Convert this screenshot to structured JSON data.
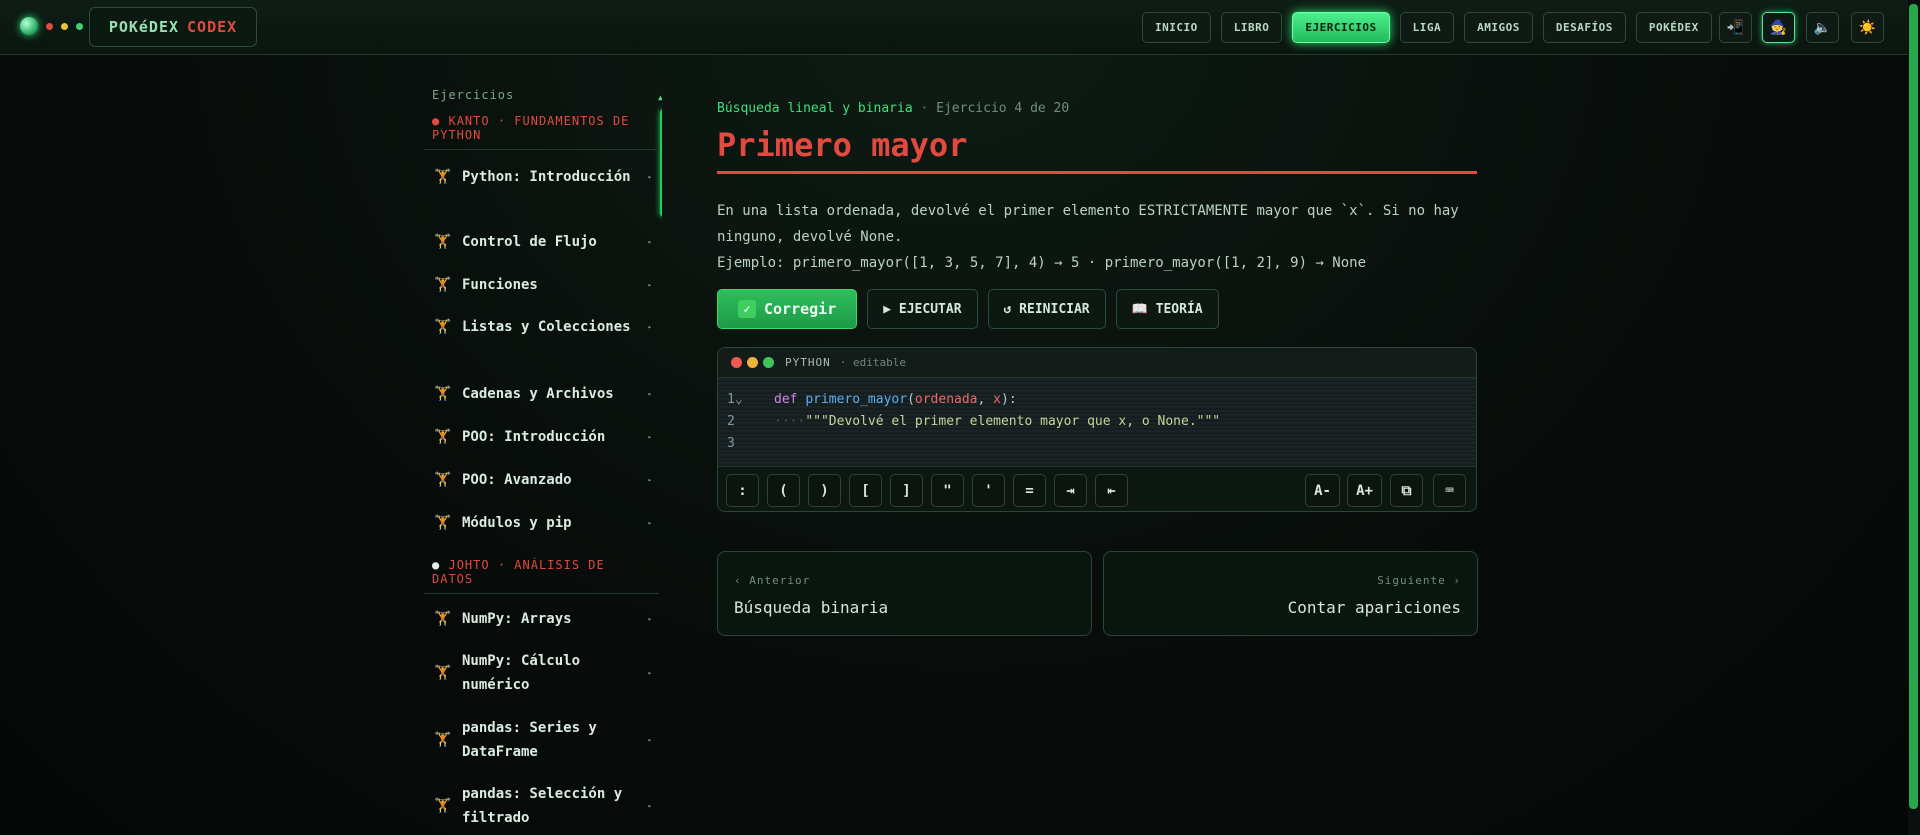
{
  "app": {
    "logo_part1": "POKéDEX",
    "logo_part2": "CODEX"
  },
  "nav": [
    {
      "label": "INICIO"
    },
    {
      "label": "LIBRO"
    },
    {
      "label": "EJERCICIOS",
      "active": true
    },
    {
      "label": "LIGA"
    },
    {
      "label": "AMIGOS"
    },
    {
      "label": "DESAFÍOS"
    },
    {
      "label": "POKÉDEX"
    }
  ],
  "toolbar_icons": [
    "install-icon",
    "trainer-icon",
    "sound-icon",
    "theme-sun-icon"
  ],
  "sidebar": {
    "title": "Ejercicios",
    "regions": [
      {
        "bullet": "●",
        "label": "KANTO · FUNDAMENTOS DE PYTHON"
      },
      {
        "bullet": "●",
        "label": "JOHTO · ANÁLISIS DE DATOS"
      }
    ],
    "items": [
      {
        "label": "Python: Introducción"
      },
      {
        "label": "Control de Flujo"
      },
      {
        "label": "Funciones"
      },
      {
        "label": "Listas y Colecciones"
      },
      {
        "label": "Cadenas y Archivos"
      },
      {
        "label": "POO: Introducción"
      },
      {
        "label": "POO: Avanzado"
      },
      {
        "label": "Módulos y pip"
      },
      {
        "label": "NumPy: Arrays"
      },
      {
        "label": "NumPy: Cálculo numérico"
      },
      {
        "label": "pandas: Series y DataFrame"
      },
      {
        "label": "pandas: Selección y filtrado"
      }
    ],
    "item_icon": "🏋",
    "item_arrow": "▸"
  },
  "exercise": {
    "topic": "Búsqueda lineal y binaria",
    "separator": "·",
    "counter": "Ejercicio 4 de 20",
    "title": "Primero mayor",
    "description": "En una lista ordenada, devolvé el primer elemento ESTRICTAMENTE mayor que `x`. Si no hay ninguno, devolvé None.",
    "example": "Ejemplo: primero_mayor([1, 3, 5, 7], 4) → 5 · primero_mayor([1, 2], 9) → None"
  },
  "actions": {
    "check": "Corregir",
    "check_icon": "✓",
    "run": "▶ EJECUTAR",
    "reset": "↺ REINICIAR",
    "theory": "📖 TEORÍA"
  },
  "editor": {
    "language": "PYTHON",
    "mode": "· editable",
    "lines": [
      {
        "n": "1⌄",
        "kw": "def",
        "fn": "primero_mayor",
        "p1": "(",
        "pa": "ordenada",
        "c": ", ",
        "pb": "x",
        "p2": "):"
      },
      {
        "n": "2",
        "ws": "····",
        "str": "\"\"\"Devolvé el primer elemento mayor que x, o None.\"\"\""
      },
      {
        "n": "3"
      }
    ],
    "keys": [
      ":",
      "(",
      ")",
      "[",
      "]",
      "\"",
      "'",
      "=",
      "⇥",
      "⇤"
    ],
    "tools": [
      "A-",
      "A+",
      "⧉",
      "⌨"
    ]
  },
  "pager": {
    "prev_small": "‹ Anterior",
    "prev_title": "Búsqueda binaria",
    "next_small": "Siguiente ›",
    "next_title": "Contar apariciones"
  }
}
